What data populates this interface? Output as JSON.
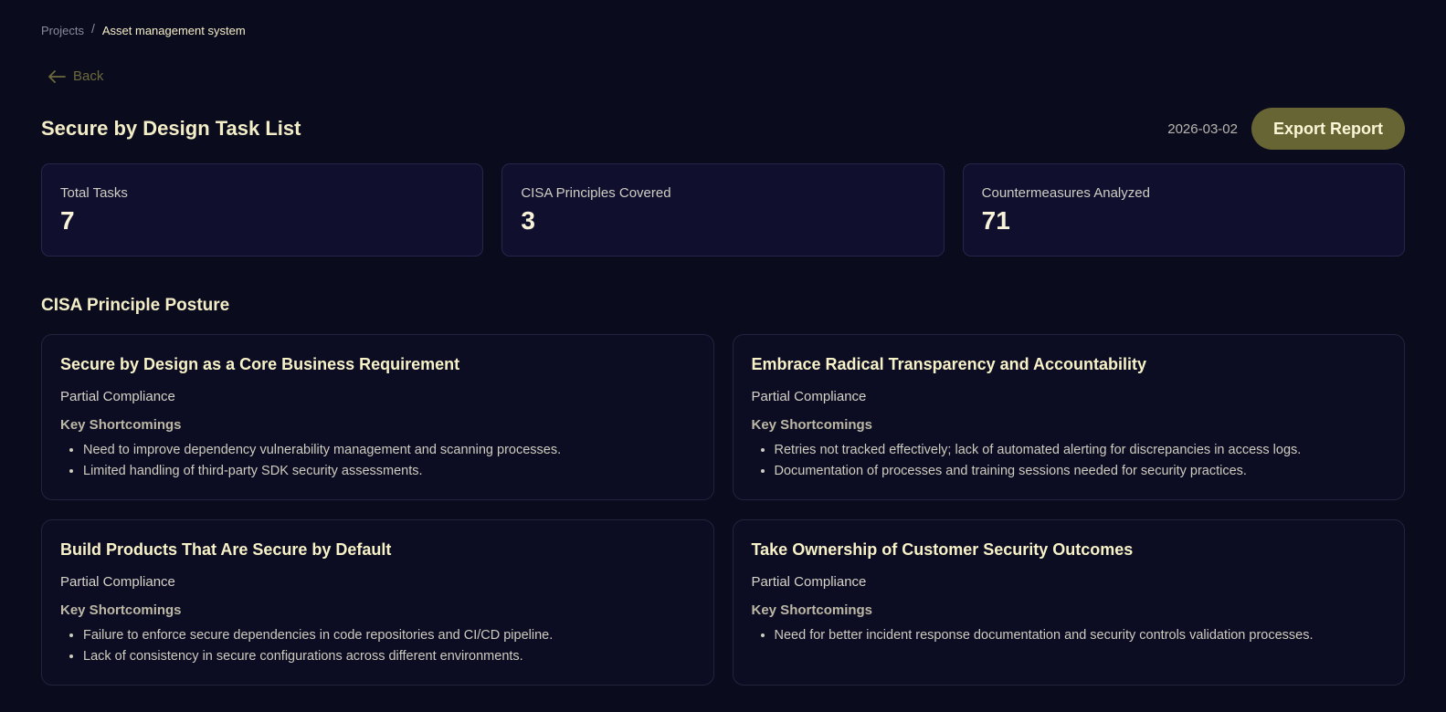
{
  "breadcrumb": {
    "parent": "Projects",
    "separator": "/",
    "current": "Asset management system"
  },
  "back": {
    "label": "Back",
    "icon": "arrow-left-icon"
  },
  "header": {
    "title": "Secure by Design Task List",
    "date": "2026-03-02",
    "export_label": "Export Report"
  },
  "stats": [
    {
      "label": "Total Tasks",
      "value": "7"
    },
    {
      "label": "CISA Principles Covered",
      "value": "3"
    },
    {
      "label": "Countermeasures Analyzed",
      "value": "71"
    }
  ],
  "section_title": "CISA Principle Posture",
  "shortcomings_heading": "Key Shortcomings",
  "principles": [
    {
      "name": "Secure by Design as a Core Business Requirement",
      "status": "Partial Compliance",
      "shortcomings": [
        "Need to improve dependency vulnerability management and scanning processes.",
        "Limited handling of third-party SDK security assessments."
      ]
    },
    {
      "name": "Embrace Radical Transparency and Accountability",
      "status": "Partial Compliance",
      "shortcomings": [
        "Retries not tracked effectively; lack of automated alerting for discrepancies in access logs.",
        "Documentation of processes and training sessions needed for security practices."
      ]
    },
    {
      "name": "Build Products That Are Secure by Default",
      "status": "Partial Compliance",
      "shortcomings": [
        "Failure to enforce secure dependencies in code repositories and CI/CD pipeline.",
        "Lack of consistency in secure configurations across different environments."
      ]
    },
    {
      "name": "Take Ownership of Customer Security Outcomes",
      "status": "Partial Compliance",
      "shortcomings": [
        "Need for better incident response documentation and security controls validation processes."
      ]
    }
  ],
  "colors": {
    "background": "#0b0b1e",
    "accent": "#686534",
    "card": "#10102e",
    "text": "#f4eec8"
  }
}
